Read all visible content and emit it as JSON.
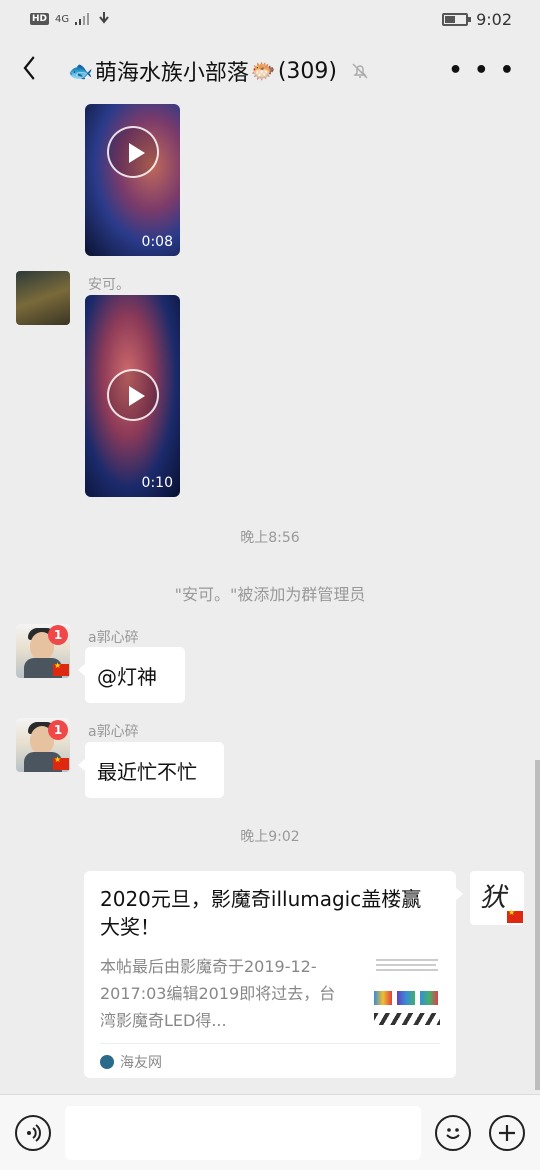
{
  "status": {
    "hd": "HD",
    "network": "4G",
    "time": "9:02",
    "battery_level": 0.45
  },
  "header": {
    "title": "萌海水族小部落",
    "count": "(309)"
  },
  "messages": {
    "video1_duration": "0:08",
    "anke_name": "安可。",
    "video2_duration": "0:10",
    "time1": "晚上8:56",
    "system_notice": "\"安可。\"被添加为群管理员",
    "guo_name": "a郭心碎",
    "guo_badge": "1",
    "guo_msg1": "@灯神",
    "guo_msg2": "最近忙不忙",
    "time2": "晚上9:02"
  },
  "card": {
    "title": "2020元旦，影魔奇illumagic盖楼赢大奖！",
    "desc": "本帖最后由影魔奇于2019-12-2017:03编辑2019即将过去，台湾影魔奇LED得...",
    "source": "海友网"
  },
  "icons": {
    "back": "chevron-left-icon",
    "mute": "bell-off-icon",
    "more": "more-icon",
    "voice": "voice-icon",
    "emoji": "emoji-icon",
    "plus": "plus-icon"
  }
}
